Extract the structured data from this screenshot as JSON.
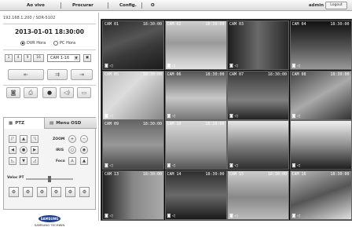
{
  "topmenu": {
    "items": [
      "Ao vivo",
      "Procurar",
      "Config.",
      "O"
    ]
  },
  "user": {
    "name": "admin",
    "logout": "Logout"
  },
  "sidebar": {
    "address": "192.168.1.200 / SDR-5102",
    "datetime": "2013-01-01 18:30:00",
    "radio_dvr": "DVR Hora",
    "radio_pc": "PC Hora",
    "split": [
      "1",
      "4",
      "9",
      "16"
    ],
    "cam_select": "CAM 1-16",
    "ptz_tab": "PTZ",
    "osd_tab": "Menu OSD",
    "zoom": "ZOOM",
    "iris": "IRIS",
    "focus": "Foco",
    "veloc": "Veloc PT",
    "brand": "SAMSUNG",
    "brand_sub": "SAMSUNG TECHWIN"
  },
  "cameras": [
    {
      "label": "CAM 01",
      "time": "18:30:00"
    },
    {
      "label": "CAM 02",
      "time": "18:30:00"
    },
    {
      "label": "CAM 03",
      "time": ""
    },
    {
      "label": "CAM 04",
      "time": "18:30:00"
    },
    {
      "label": "CAM 05",
      "time": "18:30:00"
    },
    {
      "label": "CAM 06",
      "time": "18:30:00"
    },
    {
      "label": "CAM 07",
      "time": "18:30:00"
    },
    {
      "label": "CAM 08",
      "time": "18:30:00"
    },
    {
      "label": "CAM 09",
      "time": "18:30:00"
    },
    {
      "label": "CAM 10",
      "time": "18:30:00"
    },
    {
      "label": "",
      "time": ""
    },
    {
      "label": "",
      "time": ""
    },
    {
      "label": "CAM 13",
      "time": "18:30:00"
    },
    {
      "label": "CAM 14",
      "time": "18:30:00"
    },
    {
      "label": "CAM 15",
      "time": "18:30:00"
    },
    {
      "label": "CAM 16",
      "time": "18:30:00"
    }
  ],
  "colors": {
    "brand": "#1c3d8c",
    "topbar": "#dcdcdc"
  }
}
